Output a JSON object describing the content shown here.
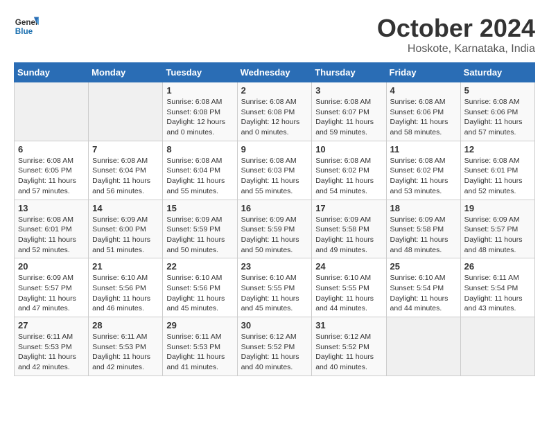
{
  "header": {
    "logo_line1": "General",
    "logo_line2": "Blue",
    "title": "October 2024",
    "location": "Hoskote, Karnataka, India"
  },
  "weekdays": [
    "Sunday",
    "Monday",
    "Tuesday",
    "Wednesday",
    "Thursday",
    "Friday",
    "Saturday"
  ],
  "weeks": [
    [
      {
        "day": "",
        "info": ""
      },
      {
        "day": "",
        "info": ""
      },
      {
        "day": "1",
        "info": "Sunrise: 6:08 AM\nSunset: 6:08 PM\nDaylight: 12 hours\nand 0 minutes."
      },
      {
        "day": "2",
        "info": "Sunrise: 6:08 AM\nSunset: 6:08 PM\nDaylight: 12 hours\nand 0 minutes."
      },
      {
        "day": "3",
        "info": "Sunrise: 6:08 AM\nSunset: 6:07 PM\nDaylight: 11 hours\nand 59 minutes."
      },
      {
        "day": "4",
        "info": "Sunrise: 6:08 AM\nSunset: 6:06 PM\nDaylight: 11 hours\nand 58 minutes."
      },
      {
        "day": "5",
        "info": "Sunrise: 6:08 AM\nSunset: 6:06 PM\nDaylight: 11 hours\nand 57 minutes."
      }
    ],
    [
      {
        "day": "6",
        "info": "Sunrise: 6:08 AM\nSunset: 6:05 PM\nDaylight: 11 hours\nand 57 minutes."
      },
      {
        "day": "7",
        "info": "Sunrise: 6:08 AM\nSunset: 6:04 PM\nDaylight: 11 hours\nand 56 minutes."
      },
      {
        "day": "8",
        "info": "Sunrise: 6:08 AM\nSunset: 6:04 PM\nDaylight: 11 hours\nand 55 minutes."
      },
      {
        "day": "9",
        "info": "Sunrise: 6:08 AM\nSunset: 6:03 PM\nDaylight: 11 hours\nand 55 minutes."
      },
      {
        "day": "10",
        "info": "Sunrise: 6:08 AM\nSunset: 6:02 PM\nDaylight: 11 hours\nand 54 minutes."
      },
      {
        "day": "11",
        "info": "Sunrise: 6:08 AM\nSunset: 6:02 PM\nDaylight: 11 hours\nand 53 minutes."
      },
      {
        "day": "12",
        "info": "Sunrise: 6:08 AM\nSunset: 6:01 PM\nDaylight: 11 hours\nand 52 minutes."
      }
    ],
    [
      {
        "day": "13",
        "info": "Sunrise: 6:08 AM\nSunset: 6:01 PM\nDaylight: 11 hours\nand 52 minutes."
      },
      {
        "day": "14",
        "info": "Sunrise: 6:09 AM\nSunset: 6:00 PM\nDaylight: 11 hours\nand 51 minutes."
      },
      {
        "day": "15",
        "info": "Sunrise: 6:09 AM\nSunset: 5:59 PM\nDaylight: 11 hours\nand 50 minutes."
      },
      {
        "day": "16",
        "info": "Sunrise: 6:09 AM\nSunset: 5:59 PM\nDaylight: 11 hours\nand 50 minutes."
      },
      {
        "day": "17",
        "info": "Sunrise: 6:09 AM\nSunset: 5:58 PM\nDaylight: 11 hours\nand 49 minutes."
      },
      {
        "day": "18",
        "info": "Sunrise: 6:09 AM\nSunset: 5:58 PM\nDaylight: 11 hours\nand 48 minutes."
      },
      {
        "day": "19",
        "info": "Sunrise: 6:09 AM\nSunset: 5:57 PM\nDaylight: 11 hours\nand 48 minutes."
      }
    ],
    [
      {
        "day": "20",
        "info": "Sunrise: 6:09 AM\nSunset: 5:57 PM\nDaylight: 11 hours\nand 47 minutes."
      },
      {
        "day": "21",
        "info": "Sunrise: 6:10 AM\nSunset: 5:56 PM\nDaylight: 11 hours\nand 46 minutes."
      },
      {
        "day": "22",
        "info": "Sunrise: 6:10 AM\nSunset: 5:56 PM\nDaylight: 11 hours\nand 45 minutes."
      },
      {
        "day": "23",
        "info": "Sunrise: 6:10 AM\nSunset: 5:55 PM\nDaylight: 11 hours\nand 45 minutes."
      },
      {
        "day": "24",
        "info": "Sunrise: 6:10 AM\nSunset: 5:55 PM\nDaylight: 11 hours\nand 44 minutes."
      },
      {
        "day": "25",
        "info": "Sunrise: 6:10 AM\nSunset: 5:54 PM\nDaylight: 11 hours\nand 44 minutes."
      },
      {
        "day": "26",
        "info": "Sunrise: 6:11 AM\nSunset: 5:54 PM\nDaylight: 11 hours\nand 43 minutes."
      }
    ],
    [
      {
        "day": "27",
        "info": "Sunrise: 6:11 AM\nSunset: 5:53 PM\nDaylight: 11 hours\nand 42 minutes."
      },
      {
        "day": "28",
        "info": "Sunrise: 6:11 AM\nSunset: 5:53 PM\nDaylight: 11 hours\nand 42 minutes."
      },
      {
        "day": "29",
        "info": "Sunrise: 6:11 AM\nSunset: 5:53 PM\nDaylight: 11 hours\nand 41 minutes."
      },
      {
        "day": "30",
        "info": "Sunrise: 6:12 AM\nSunset: 5:52 PM\nDaylight: 11 hours\nand 40 minutes."
      },
      {
        "day": "31",
        "info": "Sunrise: 6:12 AM\nSunset: 5:52 PM\nDaylight: 11 hours\nand 40 minutes."
      },
      {
        "day": "",
        "info": ""
      },
      {
        "day": "",
        "info": ""
      }
    ]
  ]
}
